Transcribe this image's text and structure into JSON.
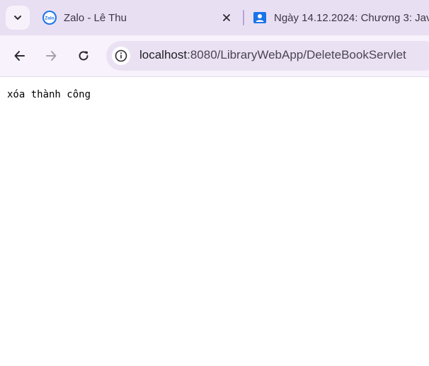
{
  "browser": {
    "tabs": [
      {
        "title": "Zalo - Lê Thu",
        "favicon_text": "Zalo"
      },
      {
        "title": "Ngày 14.12.2024: Chương 3: Jav"
      }
    ],
    "address": {
      "url_host": "localhost",
      "url_rest": ":8080/LibraryWebApp/DeleteBookServlet"
    }
  },
  "page": {
    "message": "xóa thành công"
  },
  "icons": {
    "tab_search": "chevron-down-icon",
    "tab_close": "close-icon",
    "back": "arrow-left-icon",
    "forward": "arrow-right-icon",
    "reload": "reload-icon",
    "site_info": "info-icon"
  },
  "colors": {
    "tabbar_bg": "#e9dff3",
    "toolbar_bg": "#f7f2fb",
    "omnibox_bg": "#eae2f3",
    "zalo_blue": "#1a73e8",
    "classroom_blue": "#1a73e8"
  }
}
